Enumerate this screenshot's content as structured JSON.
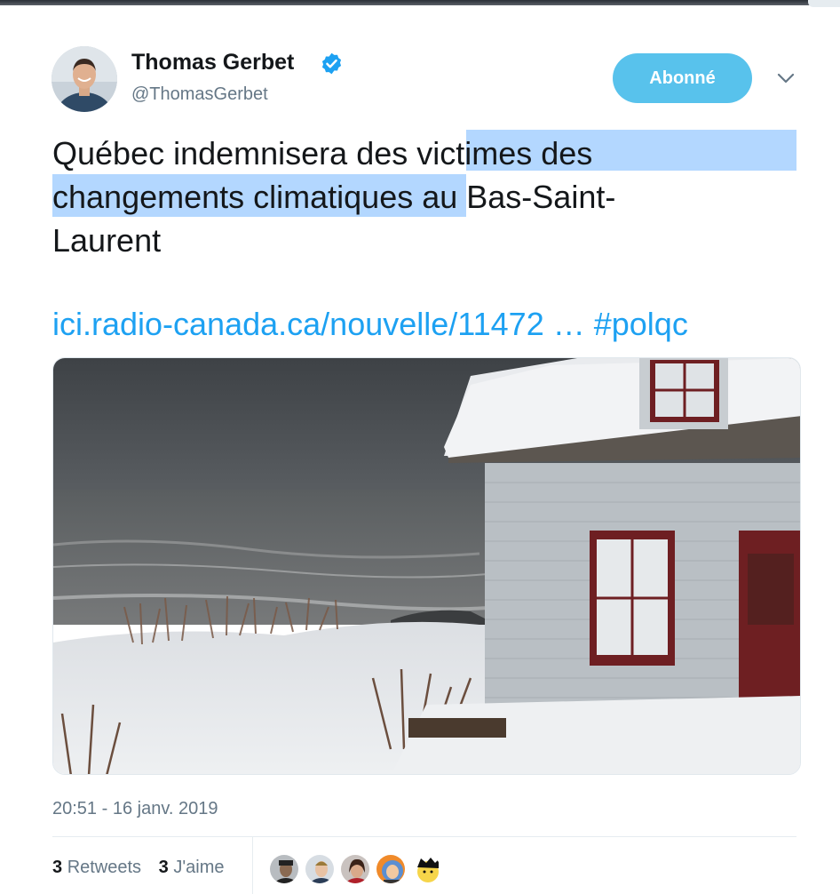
{
  "author": {
    "name": "Thomas Gerbet",
    "handle": "@ThomasGerbet",
    "verified_icon": "verified-badge-icon",
    "avatar": "profile-photo"
  },
  "follow_button": {
    "label": "Abonné",
    "color": "#58c2ec"
  },
  "menu": {
    "icon": "chevron-down-icon"
  },
  "tweet": {
    "text_line1_a": "Québec indemnisera des ",
    "text_line1_b": "victimes des",
    "text_line2_a": "changements climatiques",
    "text_line2_b": " au Bas-Saint-",
    "text_line3": "Laurent",
    "link": "ici.radio-canada.ca/nouvelle/11472 …",
    "hashtag": "#polqc",
    "highlight_color": "#b3d7ff",
    "link_color": "#1da1f2"
  },
  "media": {
    "description_icon": "photo-snowy-coastal-house"
  },
  "timestamp": "20:51 - 16 janv. 2019",
  "stats": {
    "retweets_count": "3",
    "retweets_label": "Retweets",
    "likes_count": "3",
    "likes_label": "J'aime"
  }
}
